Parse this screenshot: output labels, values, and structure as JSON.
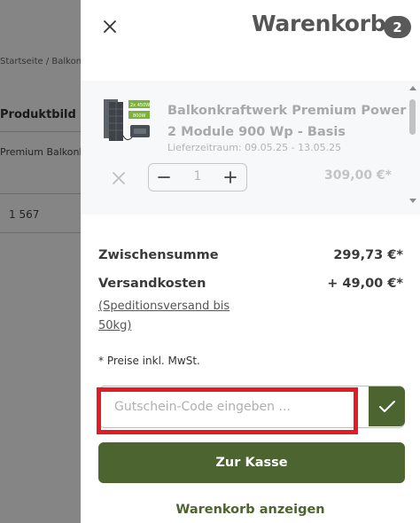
{
  "background_page": {
    "lines": [
      "Startseite / Balkonkr",
      "Produktbild",
      "Premium Balkonkraftw",
      "1  567"
    ]
  },
  "cart": {
    "title": "Warenkorb",
    "item_count": "2",
    "items": [
      {
        "name": "Balkonkraftwerk Premium Power 2 Module 900 Wp - Basis",
        "delivery": "Lieferzeitraum: 09.05.25 - 13.05.25",
        "quantity": "1",
        "price": "309,00 €*",
        "image_labels": [
          "2x 450W",
          "800W"
        ]
      }
    ],
    "summary": {
      "subtotal_label": "Zwischensumme",
      "subtotal_value": "299,73 €*",
      "shipping_label": "Versandkosten",
      "shipping_value": "+ 49,00 €*",
      "shipping_note": "(Speditionsversand bis 50kg)",
      "tax_note": "* Preise inkl. MwSt."
    },
    "coupon": {
      "placeholder": "Gutschein-Code eingeben ..."
    },
    "checkout_label": "Zur Kasse",
    "view_cart_label": "Warenkorb anzeigen"
  },
  "colors": {
    "brand_green": "#4c6430",
    "highlight_red": "#e31b23",
    "badge_gray": "#595959"
  },
  "icons": [
    "close-icon",
    "remove-item-icon",
    "minus-icon",
    "plus-icon",
    "checkmark-icon"
  ]
}
